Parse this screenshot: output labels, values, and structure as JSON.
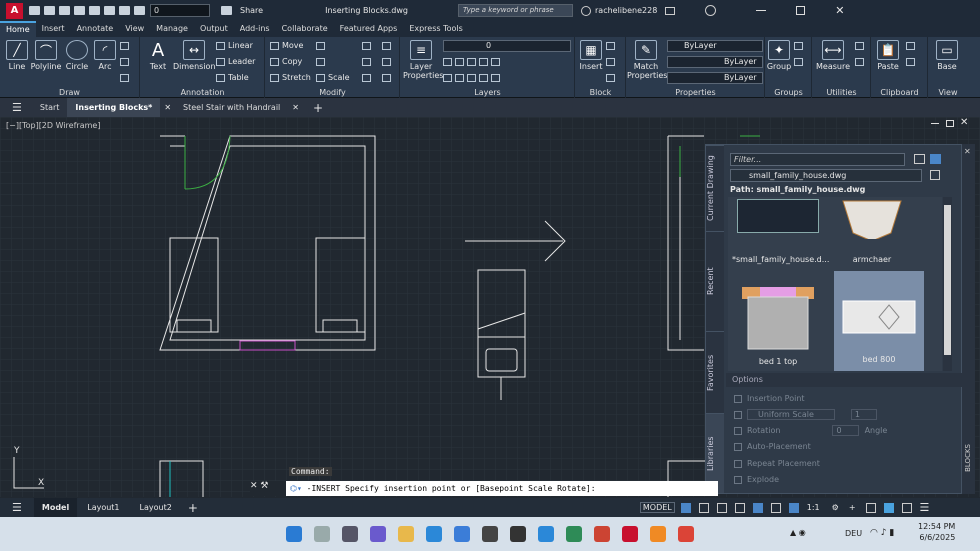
{
  "title": {
    "app_letter": "A",
    "layer_field": "0",
    "share": "Share",
    "doc_title": "Inserting Blocks.dwg",
    "search_placeholder": "Type a keyword or phrase",
    "user": "rachelibene228"
  },
  "ribbon_tabs": [
    "Home",
    "Insert",
    "Annotate",
    "View",
    "Manage",
    "Output",
    "Add-ins",
    "Collaborate",
    "Featured Apps",
    "Express Tools"
  ],
  "draw": {
    "line": "Line",
    "polyline": "Polyline",
    "circle": "Circle",
    "arc": "Arc",
    "title": "Draw"
  },
  "annotation": {
    "text": "Text",
    "dimension": "Dimension",
    "linear": "Linear",
    "leader": "Leader",
    "table": "Table",
    "title": "Annotation"
  },
  "modify": {
    "move": "Move",
    "copy": "Copy",
    "stretch": "Stretch",
    "rotate": "",
    "mirror": "",
    "scale": "Scale",
    "title": "Modify"
  },
  "layers": {
    "props": "Layer Properties",
    "current": "0",
    "title": "Layers"
  },
  "block": {
    "insert": "Insert",
    "title": "Block"
  },
  "properties": {
    "match": "Match Properties",
    "color": "ByLayer",
    "linetype": "ByLayer",
    "lineweight": "ByLayer",
    "title": "Properties"
  },
  "groups": {
    "group": "Group",
    "title": "Groups"
  },
  "utilities": {
    "measure": "Measure",
    "title": "Utilities"
  },
  "clipboard": {
    "paste": "Paste",
    "title": "Clipboard"
  },
  "view": {
    "base": "Base",
    "title": "View"
  },
  "doc_tabs": [
    "Start",
    "Inserting Blocks*",
    "Steel Stair with Handrail"
  ],
  "view_label": "[−][Top][2D Wireframe]",
  "palette": {
    "filter_placeholder": "Filter...",
    "file": "small_family_house.dwg",
    "path": "Path: small_family_house.dwg",
    "side_tabs": [
      "Current Drawing",
      "Recent",
      "Favorites",
      "Libraries"
    ],
    "blocks": [
      "*small_family_house.d...",
      "armchaer",
      "bed 1 top",
      "bed 800"
    ],
    "options_title": "Options",
    "options": [
      "Insertion Point",
      "Uniform Scale",
      "Rotation",
      "Auto-Placement",
      "Repeat Placement",
      "Explode"
    ],
    "scale_value": "1",
    "rotation_value": "0",
    "angle_label": "Angle",
    "side_label": "BLOCKS"
  },
  "command": {
    "history": "Command:",
    "prompt": "-INSERT Specify insertion point or [Basepoint Scale Rotate]:"
  },
  "status": {
    "tabs": [
      "Model",
      "Layout1",
      "Layout2"
    ],
    "model": "MODEL",
    "scale": "1:1"
  },
  "axis": {
    "y": "Y",
    "x": "X"
  },
  "taskbar": {
    "lang": "DEU",
    "time": "12:54 PM",
    "date": "6/6/2025"
  }
}
